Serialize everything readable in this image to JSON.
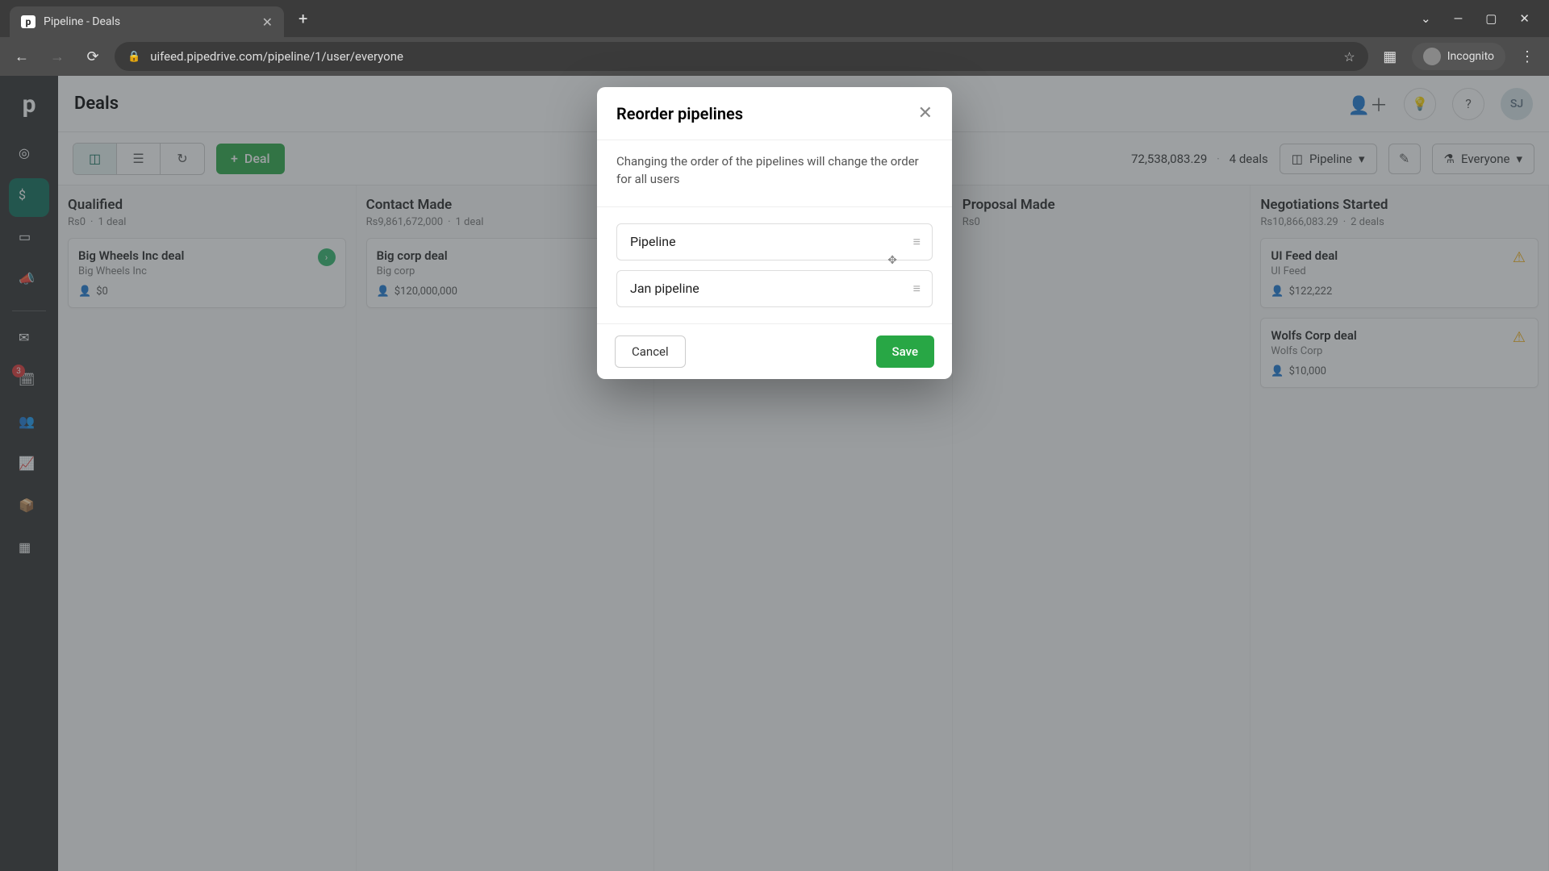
{
  "browser": {
    "tab_title": "Pipeline - Deals",
    "url": "uifeed.pipedrive.com/pipeline/1/user/everyone",
    "incognito_label": "Incognito"
  },
  "header": {
    "page_title": "Deals",
    "user_initials": "SJ"
  },
  "toolbar": {
    "deal_button": "Deal",
    "summary_amount": "72,538,083.29",
    "summary_deals": "4 deals",
    "pipeline_selector": "Pipeline",
    "scope_selector": "Everyone"
  },
  "sidebar": {
    "badge_count": "3"
  },
  "columns": [
    {
      "name": "Qualified",
      "amount": "Rs0",
      "count": "1 deal",
      "cards": [
        {
          "title": "Big Wheels Inc deal",
          "org": "Big Wheels Inc",
          "value": "$0",
          "indicator": "green"
        }
      ]
    },
    {
      "name": "Contact Made",
      "amount": "Rs9,861,672,000",
      "count": "1 deal",
      "cards": [
        {
          "title": "Big corp deal",
          "org": "Big corp",
          "value": "$120,000,000",
          "indicator": ""
        }
      ]
    },
    {
      "name": "",
      "amount": "",
      "count": "",
      "cards": []
    },
    {
      "name": "Proposal Made",
      "amount": "Rs0",
      "count": "",
      "cards": []
    },
    {
      "name": "Negotiations Started",
      "amount": "Rs10,866,083.29",
      "count": "2 deals",
      "cards": [
        {
          "title": "UI Feed deal",
          "org": "UI Feed",
          "value": "$122,222",
          "indicator": "warn"
        },
        {
          "title": "Wolfs Corp deal",
          "org": "Wolfs Corp",
          "value": "$10,000",
          "indicator": "warn"
        }
      ]
    }
  ],
  "modal": {
    "title": "Reorder pipelines",
    "description": "Changing the order of the pipelines will change the order for all users",
    "items": [
      "Pipeline",
      "Jan pipeline"
    ],
    "cancel": "Cancel",
    "save": "Save"
  }
}
